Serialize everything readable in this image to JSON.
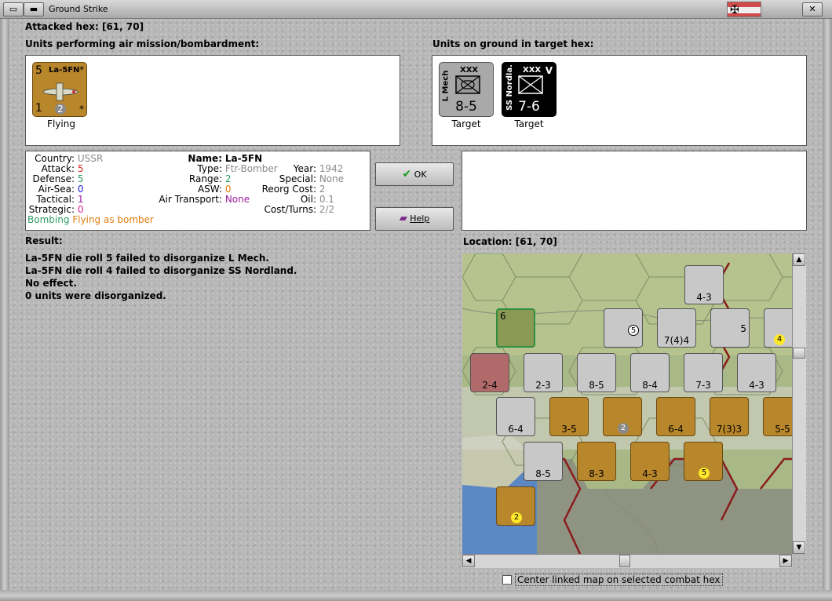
{
  "window": {
    "title": "Ground Strike"
  },
  "attacked_hex": {
    "label": "Attacked hex:",
    "value": "[61, 70]"
  },
  "air_units": {
    "heading": "Units performing air mission/bombardment:",
    "units": [
      {
        "name": "La-5FN",
        "attack": "5",
        "value_bottom_left": "1",
        "value_bottom_mid": "2",
        "star_top": "*",
        "star_bottom": "*",
        "status": "Flying",
        "color": "#b8862b"
      }
    ]
  },
  "ground_units": {
    "heading": "Units on ground in target hex:",
    "units": [
      {
        "name": "L Mech",
        "size": "XXX",
        "strength": "8-5",
        "status": "Target",
        "color": "#a9a9a9"
      },
      {
        "name": "SS Nordla.",
        "size": "XXX",
        "strength": "7-6",
        "extra": "V",
        "status": "Target",
        "color": "#000000"
      }
    ]
  },
  "unit_details": {
    "country_label": "Country:",
    "country": "USSR",
    "attack_label": "Attack:",
    "attack": "5",
    "defense_label": "Defense:",
    "defense": "5",
    "air_sea_label": "Air-Sea:",
    "air_sea": "0",
    "tactical_label": "Tactical:",
    "tactical": "1",
    "strategic_label": "Strategic:",
    "strategic": "0",
    "mission": "Bombing",
    "mission_note": "Flying as bomber",
    "name_label": "Name:",
    "name": "La-5FN",
    "type_label": "Type:",
    "type": "Ftr-Bomber",
    "range_label": "Range:",
    "range": "2",
    "asw_label": "ASW:",
    "asw": "0",
    "air_transport_label": "Air Transport:",
    "air_transport": "None",
    "year_label": "Year:",
    "year": "1942",
    "special_label": "Special:",
    "special": "None",
    "reorg_label": "Reorg Cost:",
    "reorg": "2",
    "oil_label": "Oil:",
    "oil": "0.1",
    "cost_label": "Cost/Turns:",
    "cost": "2/2"
  },
  "buttons": {
    "ok": "OK",
    "help": "Help"
  },
  "result": {
    "heading": "Result:",
    "lines": [
      "La-5FN die roll 5 failed to disorganize L Mech.",
      "La-5FN die roll 4 failed to disorganize SS Nordland.",
      "No effect.",
      "0 units were disorganized."
    ]
  },
  "location": {
    "label": "Location:",
    "value": "[61, 70]"
  },
  "map_counters": [
    {
      "label": "4-3",
      "color": "#c8c8c8"
    },
    {
      "label": "6",
      "color": "#8a9a55"
    },
    {
      "label": "5",
      "color": "#c8c8c8"
    },
    {
      "label": "7(4)4",
      "color": "#c8c8c8"
    },
    {
      "label": "5",
      "color": "#c8c8c8"
    },
    {
      "label": "4",
      "color": "#c8c8c8"
    },
    {
      "label": "2-4",
      "color": "#b06a6a"
    },
    {
      "label": "2-3",
      "color": "#c8c8c8"
    },
    {
      "label": "8-5",
      "color": "#c8c8c8"
    },
    {
      "label": "8-4",
      "color": "#c8c8c8"
    },
    {
      "label": "7-3",
      "color": "#c8c8c8"
    },
    {
      "label": "4-3",
      "color": "#c8c8c8"
    },
    {
      "label": "6-4",
      "color": "#c8c8c8"
    },
    {
      "label": "3-5",
      "color": "#b8862b"
    },
    {
      "label": "2",
      "color": "#b8862b"
    },
    {
      "label": "6-4",
      "color": "#b8862b"
    },
    {
      "label": "7(3)3",
      "color": "#b8862b"
    },
    {
      "label": "5-5",
      "color": "#b8862b"
    },
    {
      "label": "8-5",
      "color": "#c8c8c8"
    },
    {
      "label": "8-3",
      "color": "#b8862b"
    },
    {
      "label": "4-3",
      "color": "#b8862b"
    },
    {
      "label": "5",
      "color": "#b8862b"
    },
    {
      "label": "2",
      "color": "#b8862b"
    }
  ],
  "checkbox": {
    "label": "Center linked map on selected combat hex",
    "checked": false
  },
  "colors": {
    "green": "#2e9b62",
    "red": "#e02020",
    "blue": "#2020e0",
    "orange": "#e07d10",
    "purple": "#9b1ea0",
    "grey": "#8a8a8a"
  },
  "icons": [
    "window-menu-icon",
    "minimize-icon",
    "close-icon",
    "check-icon",
    "help-book-icon",
    "flag-icon"
  ]
}
